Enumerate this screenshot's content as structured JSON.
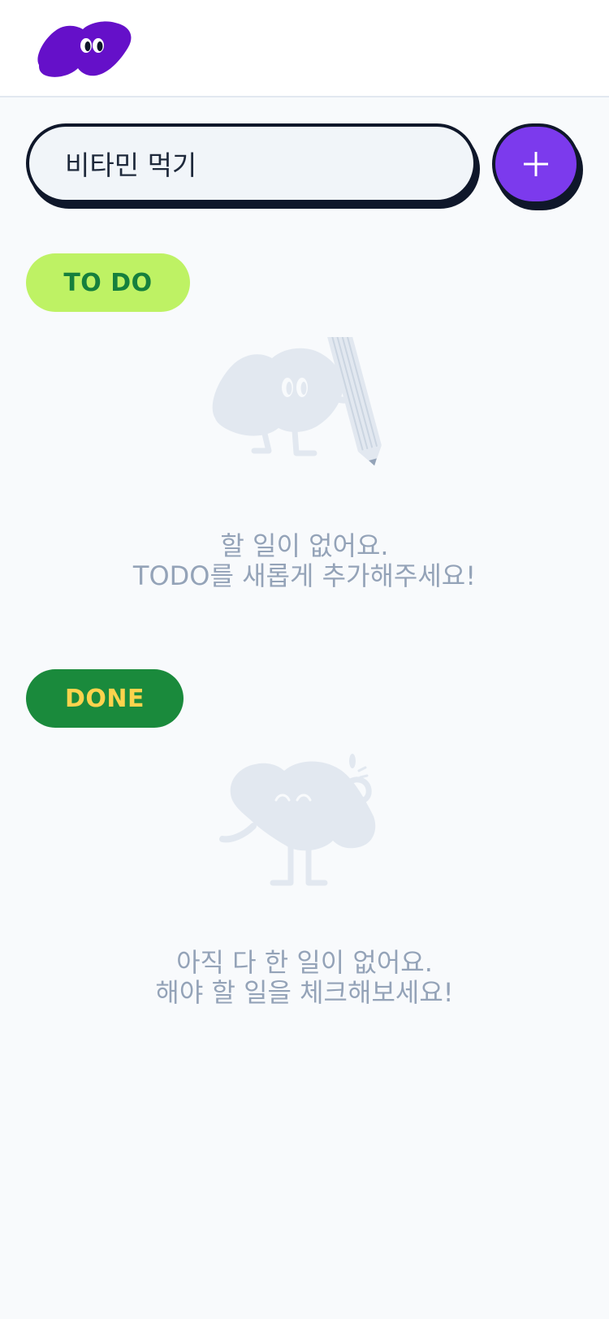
{
  "header": {
    "logo_icon": "purple-blob-logo-icon"
  },
  "input": {
    "value": "비타민 먹기",
    "add_icon": "plus-icon",
    "colors": {
      "field_bg": "#F1F5F9",
      "border": "#0F172A",
      "add_button": "#7C3AED"
    }
  },
  "todo_section": {
    "label": "TO DO",
    "illustration": "blob-with-pencil-icon",
    "empty_line1": "할 일이 없어요.",
    "empty_line2": "TODO를 새롭게 추가해주세요!",
    "colors": {
      "badge_bg": "#BEF264",
      "badge_text": "#15803D"
    }
  },
  "done_section": {
    "label": "DONE",
    "illustration": "sleepy-blob-icon",
    "empty_line1": "아직 다 한 일이 없어요.",
    "empty_line2": "해야 할 일을 체크해보세요!",
    "colors": {
      "badge_bg": "#1A8A3C",
      "badge_text": "#FCD34D"
    }
  }
}
